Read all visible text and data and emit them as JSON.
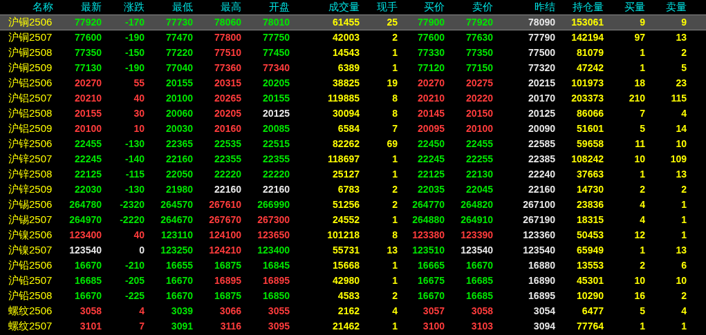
{
  "columns": [
    {
      "label": "名称",
      "kind": "name"
    },
    {
      "label": "最新",
      "kind": "price"
    },
    {
      "label": "涨跌",
      "kind": "price"
    },
    {
      "label": "最低",
      "kind": "price"
    },
    {
      "label": "最高",
      "kind": "price"
    },
    {
      "label": "开盘",
      "kind": "price"
    },
    {
      "label": "成交量",
      "kind": "volume"
    },
    {
      "label": "现手",
      "kind": "volume"
    },
    {
      "label": "买价",
      "kind": "price"
    },
    {
      "label": "卖价",
      "kind": "price"
    },
    {
      "label": "昨结",
      "kind": "base"
    },
    {
      "label": "持仓量",
      "kind": "volume"
    },
    {
      "label": "买量",
      "kind": "volume"
    },
    {
      "label": "卖量",
      "kind": "volume"
    }
  ],
  "rows": [
    {
      "selected": true,
      "cells": [
        "沪铜2506",
        {
          "text": "77920",
          "color": "#00e600"
        },
        {
          "text": "-170",
          "color": "#00e600"
        },
        {
          "text": "77730",
          "color": "#00e600"
        },
        {
          "text": "78060",
          "color": "#00e600"
        },
        {
          "text": "78010",
          "color": "#00e600"
        },
        "61455",
        "25",
        {
          "text": "77900",
          "color": "#00e600"
        },
        {
          "text": "77920",
          "color": "#00e600"
        },
        "78090",
        "153061",
        "9",
        "9"
      ]
    },
    {
      "selected": false,
      "cells": [
        "沪铜2507",
        {
          "text": "77600",
          "color": "#00e600"
        },
        {
          "text": "-190",
          "color": "#00e600"
        },
        {
          "text": "77470",
          "color": "#00e600"
        },
        {
          "text": "77800",
          "color": "#ff3c3c"
        },
        {
          "text": "77750",
          "color": "#00e600"
        },
        "42003",
        "2",
        {
          "text": "77600",
          "color": "#00e600"
        },
        {
          "text": "77630",
          "color": "#00e600"
        },
        "77790",
        "142194",
        "97",
        "13"
      ]
    },
    {
      "selected": false,
      "cells": [
        "沪铜2508",
        {
          "text": "77350",
          "color": "#00e600"
        },
        {
          "text": "-150",
          "color": "#00e600"
        },
        {
          "text": "77220",
          "color": "#00e600"
        },
        {
          "text": "77510",
          "color": "#ff3c3c"
        },
        {
          "text": "77450",
          "color": "#00e600"
        },
        "14543",
        "1",
        {
          "text": "77330",
          "color": "#00e600"
        },
        {
          "text": "77350",
          "color": "#00e600"
        },
        "77500",
        "81079",
        "1",
        "2"
      ]
    },
    {
      "selected": false,
      "cells": [
        "沪铜2509",
        {
          "text": "77130",
          "color": "#00e600"
        },
        {
          "text": "-190",
          "color": "#00e600"
        },
        {
          "text": "77040",
          "color": "#00e600"
        },
        {
          "text": "77360",
          "color": "#ff3c3c"
        },
        {
          "text": "77340",
          "color": "#ff3c3c"
        },
        "6389",
        "1",
        {
          "text": "77120",
          "color": "#00e600"
        },
        {
          "text": "77150",
          "color": "#00e600"
        },
        "77320",
        "47242",
        "1",
        "5"
      ]
    },
    {
      "selected": false,
      "cells": [
        "沪铝2506",
        {
          "text": "20270",
          "color": "#ff3c3c"
        },
        {
          "text": "55",
          "color": "#ff3c3c"
        },
        {
          "text": "20155",
          "color": "#00e600"
        },
        {
          "text": "20315",
          "color": "#ff3c3c"
        },
        {
          "text": "20205",
          "color": "#00e600"
        },
        "38825",
        "19",
        {
          "text": "20270",
          "color": "#ff3c3c"
        },
        {
          "text": "20275",
          "color": "#ff3c3c"
        },
        "20215",
        "101973",
        "18",
        "23"
      ]
    },
    {
      "selected": false,
      "cells": [
        "沪铝2507",
        {
          "text": "20210",
          "color": "#ff3c3c"
        },
        {
          "text": "40",
          "color": "#ff3c3c"
        },
        {
          "text": "20100",
          "color": "#00e600"
        },
        {
          "text": "20265",
          "color": "#ff3c3c"
        },
        {
          "text": "20155",
          "color": "#00e600"
        },
        "119885",
        "8",
        {
          "text": "20210",
          "color": "#ff3c3c"
        },
        {
          "text": "20220",
          "color": "#ff3c3c"
        },
        "20170",
        "203373",
        "210",
        "115"
      ]
    },
    {
      "selected": false,
      "cells": [
        "沪铝2508",
        {
          "text": "20155",
          "color": "#ff3c3c"
        },
        {
          "text": "30",
          "color": "#ff3c3c"
        },
        {
          "text": "20060",
          "color": "#00e600"
        },
        {
          "text": "20205",
          "color": "#ff3c3c"
        },
        {
          "text": "20125",
          "color": "#e8e8e8"
        },
        "30094",
        "8",
        {
          "text": "20145",
          "color": "#ff3c3c"
        },
        {
          "text": "20150",
          "color": "#ff3c3c"
        },
        "20125",
        "86066",
        "7",
        "4"
      ]
    },
    {
      "selected": false,
      "cells": [
        "沪铝2509",
        {
          "text": "20100",
          "color": "#ff3c3c"
        },
        {
          "text": "10",
          "color": "#ff3c3c"
        },
        {
          "text": "20030",
          "color": "#00e600"
        },
        {
          "text": "20160",
          "color": "#ff3c3c"
        },
        {
          "text": "20085",
          "color": "#00e600"
        },
        "6584",
        "7",
        {
          "text": "20095",
          "color": "#ff3c3c"
        },
        {
          "text": "20100",
          "color": "#ff3c3c"
        },
        "20090",
        "51601",
        "5",
        "14"
      ]
    },
    {
      "selected": false,
      "cells": [
        "沪锌2506",
        {
          "text": "22455",
          "color": "#00e600"
        },
        {
          "text": "-130",
          "color": "#00e600"
        },
        {
          "text": "22365",
          "color": "#00e600"
        },
        {
          "text": "22535",
          "color": "#00e600"
        },
        {
          "text": "22515",
          "color": "#00e600"
        },
        "82262",
        "69",
        {
          "text": "22450",
          "color": "#00e600"
        },
        {
          "text": "22455",
          "color": "#00e600"
        },
        "22585",
        "59658",
        "11",
        "10"
      ]
    },
    {
      "selected": false,
      "cells": [
        "沪锌2507",
        {
          "text": "22245",
          "color": "#00e600"
        },
        {
          "text": "-140",
          "color": "#00e600"
        },
        {
          "text": "22160",
          "color": "#00e600"
        },
        {
          "text": "22355",
          "color": "#00e600"
        },
        {
          "text": "22355",
          "color": "#00e600"
        },
        "118697",
        "1",
        {
          "text": "22245",
          "color": "#00e600"
        },
        {
          "text": "22255",
          "color": "#00e600"
        },
        "22385",
        "108242",
        "10",
        "109"
      ]
    },
    {
      "selected": false,
      "cells": [
        "沪锌2508",
        {
          "text": "22125",
          "color": "#00e600"
        },
        {
          "text": "-115",
          "color": "#00e600"
        },
        {
          "text": "22050",
          "color": "#00e600"
        },
        {
          "text": "22220",
          "color": "#00e600"
        },
        {
          "text": "22220",
          "color": "#00e600"
        },
        "25127",
        "1",
        {
          "text": "22125",
          "color": "#00e600"
        },
        {
          "text": "22130",
          "color": "#00e600"
        },
        "22240",
        "37663",
        "1",
        "13"
      ]
    },
    {
      "selected": false,
      "cells": [
        "沪锌2509",
        {
          "text": "22030",
          "color": "#00e600"
        },
        {
          "text": "-130",
          "color": "#00e600"
        },
        {
          "text": "21980",
          "color": "#00e600"
        },
        {
          "text": "22160",
          "color": "#e8e8e8"
        },
        {
          "text": "22160",
          "color": "#e8e8e8"
        },
        "6783",
        "2",
        {
          "text": "22035",
          "color": "#00e600"
        },
        {
          "text": "22045",
          "color": "#00e600"
        },
        "22160",
        "14730",
        "2",
        "2"
      ]
    },
    {
      "selected": false,
      "cells": [
        "沪锡2506",
        {
          "text": "264780",
          "color": "#00e600"
        },
        {
          "text": "-2320",
          "color": "#00e600"
        },
        {
          "text": "264570",
          "color": "#00e600"
        },
        {
          "text": "267610",
          "color": "#ff3c3c"
        },
        {
          "text": "266990",
          "color": "#00e600"
        },
        "51256",
        "2",
        {
          "text": "264770",
          "color": "#00e600"
        },
        {
          "text": "264820",
          "color": "#00e600"
        },
        "267100",
        "23836",
        "4",
        "1"
      ]
    },
    {
      "selected": false,
      "cells": [
        "沪锡2507",
        {
          "text": "264970",
          "color": "#00e600"
        },
        {
          "text": "-2220",
          "color": "#00e600"
        },
        {
          "text": "264670",
          "color": "#00e600"
        },
        {
          "text": "267670",
          "color": "#ff3c3c"
        },
        {
          "text": "267300",
          "color": "#ff3c3c"
        },
        "24552",
        "1",
        {
          "text": "264880",
          "color": "#00e600"
        },
        {
          "text": "264910",
          "color": "#00e600"
        },
        "267190",
        "18315",
        "4",
        "1"
      ]
    },
    {
      "selected": false,
      "cells": [
        "沪镍2506",
        {
          "text": "123400",
          "color": "#ff3c3c"
        },
        {
          "text": "40",
          "color": "#ff3c3c"
        },
        {
          "text": "123110",
          "color": "#00e600"
        },
        {
          "text": "124100",
          "color": "#ff3c3c"
        },
        {
          "text": "123650",
          "color": "#ff3c3c"
        },
        "101218",
        "8",
        {
          "text": "123380",
          "color": "#ff3c3c"
        },
        {
          "text": "123390",
          "color": "#ff3c3c"
        },
        "123360",
        "50453",
        "12",
        "1"
      ]
    },
    {
      "selected": false,
      "cells": [
        "沪镍2507",
        {
          "text": "123540",
          "color": "#e8e8e8"
        },
        {
          "text": "0",
          "color": "#e8e8e8"
        },
        {
          "text": "123250",
          "color": "#00e600"
        },
        {
          "text": "124210",
          "color": "#ff3c3c"
        },
        {
          "text": "123400",
          "color": "#00e600"
        },
        "55731",
        "13",
        {
          "text": "123510",
          "color": "#00e600"
        },
        {
          "text": "123540",
          "color": "#e8e8e8"
        },
        "123540",
        "65949",
        "1",
        "13"
      ]
    },
    {
      "selected": false,
      "cells": [
        "沪铅2506",
        {
          "text": "16670",
          "color": "#00e600"
        },
        {
          "text": "-210",
          "color": "#00e600"
        },
        {
          "text": "16655",
          "color": "#00e600"
        },
        {
          "text": "16875",
          "color": "#00e600"
        },
        {
          "text": "16845",
          "color": "#00e600"
        },
        "15668",
        "1",
        {
          "text": "16665",
          "color": "#00e600"
        },
        {
          "text": "16670",
          "color": "#00e600"
        },
        "16880",
        "13553",
        "2",
        "6"
      ]
    },
    {
      "selected": false,
      "cells": [
        "沪铅2507",
        {
          "text": "16685",
          "color": "#00e600"
        },
        {
          "text": "-205",
          "color": "#00e600"
        },
        {
          "text": "16670",
          "color": "#00e600"
        },
        {
          "text": "16895",
          "color": "#ff3c3c"
        },
        {
          "text": "16895",
          "color": "#ff3c3c"
        },
        "42980",
        "1",
        {
          "text": "16675",
          "color": "#00e600"
        },
        {
          "text": "16685",
          "color": "#00e600"
        },
        "16890",
        "45301",
        "10",
        "10"
      ]
    },
    {
      "selected": false,
      "cells": [
        "沪铅2508",
        {
          "text": "16670",
          "color": "#00e600"
        },
        {
          "text": "-225",
          "color": "#00e600"
        },
        {
          "text": "16670",
          "color": "#00e600"
        },
        {
          "text": "16875",
          "color": "#00e600"
        },
        {
          "text": "16850",
          "color": "#00e600"
        },
        "4583",
        "2",
        {
          "text": "16670",
          "color": "#00e600"
        },
        {
          "text": "16685",
          "color": "#00e600"
        },
        "16895",
        "10290",
        "16",
        "2"
      ]
    },
    {
      "selected": false,
      "cells": [
        "螺纹2506",
        {
          "text": "3058",
          "color": "#ff3c3c"
        },
        {
          "text": "4",
          "color": "#ff3c3c"
        },
        {
          "text": "3039",
          "color": "#00e600"
        },
        {
          "text": "3066",
          "color": "#ff3c3c"
        },
        {
          "text": "3055",
          "color": "#ff3c3c"
        },
        "2162",
        "4",
        {
          "text": "3057",
          "color": "#ff3c3c"
        },
        {
          "text": "3058",
          "color": "#ff3c3c"
        },
        "3054",
        "6477",
        "5",
        "4"
      ]
    },
    {
      "selected": false,
      "cells": [
        "螺纹2507",
        {
          "text": "3101",
          "color": "#ff3c3c"
        },
        {
          "text": "7",
          "color": "#ff3c3c"
        },
        {
          "text": "3091",
          "color": "#00e600"
        },
        {
          "text": "3116",
          "color": "#ff3c3c"
        },
        {
          "text": "3095",
          "color": "#ff3c3c"
        },
        "21462",
        "1",
        {
          "text": "3100",
          "color": "#ff3c3c"
        },
        {
          "text": "3103",
          "color": "#ff3c3c"
        },
        "3094",
        "77764",
        "1",
        "1"
      ]
    }
  ]
}
